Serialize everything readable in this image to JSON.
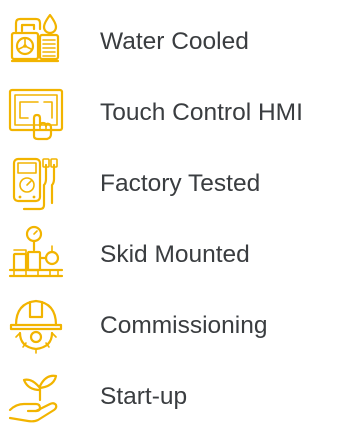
{
  "accent_color": "#f2b400",
  "text_color": "#3a3d40",
  "features": [
    {
      "icon": "water-cooled-icon",
      "label": "Water Cooled"
    },
    {
      "icon": "touch-control-hmi-icon",
      "label": "Touch Control HMI"
    },
    {
      "icon": "factory-tested-icon",
      "label": "Factory Tested"
    },
    {
      "icon": "skid-mounted-icon",
      "label": "Skid Mounted"
    },
    {
      "icon": "commissioning-icon",
      "label": "Commissioning"
    },
    {
      "icon": "start-up-icon",
      "label": "Start-up"
    }
  ]
}
